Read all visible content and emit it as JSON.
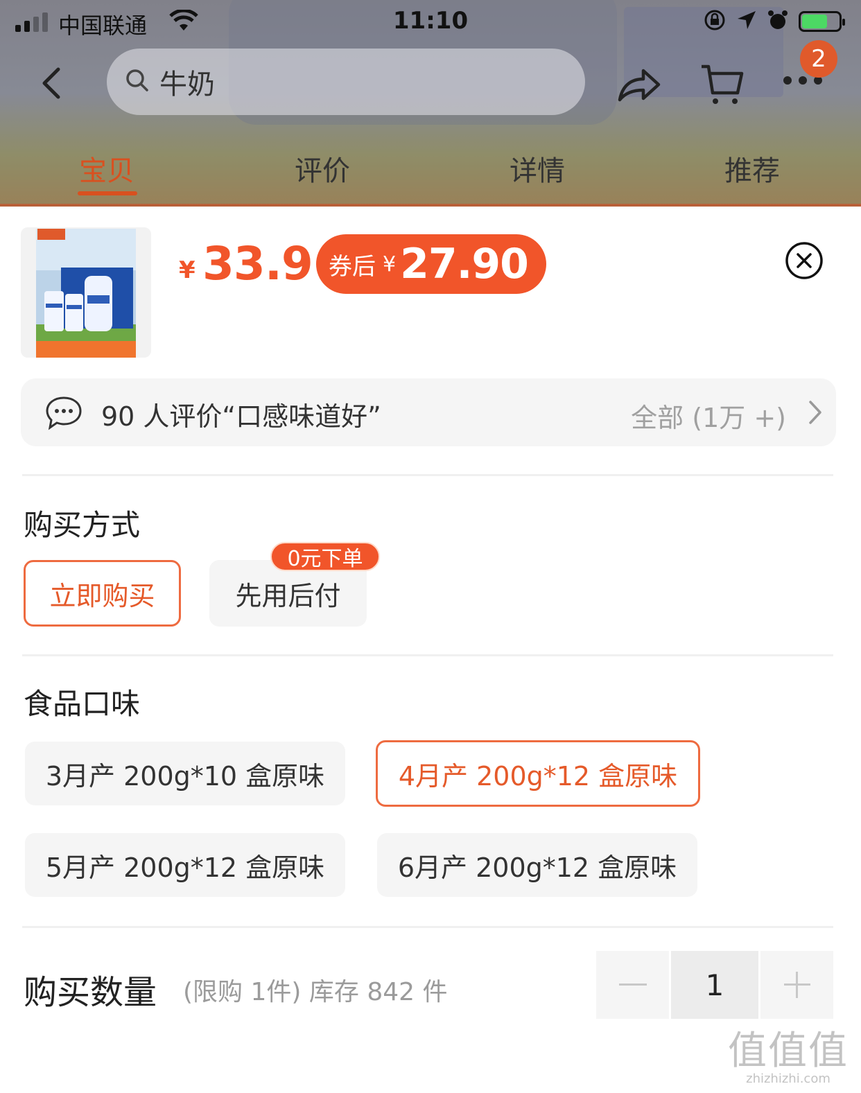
{
  "status_bar": {
    "carrier": "中国联通",
    "time": "11:10"
  },
  "nav": {
    "search_text": "牛奶",
    "cart_badge": "2"
  },
  "tabs": [
    {
      "label": "宝贝",
      "active": true
    },
    {
      "label": "评价",
      "active": false
    },
    {
      "label": "详情",
      "active": false
    },
    {
      "label": "推荐",
      "active": false
    }
  ],
  "product": {
    "currency": "¥",
    "price": "33.9",
    "coupon_label": "券后",
    "coupon_currency": "¥",
    "coupon_price": "27.90"
  },
  "review_bar": {
    "summary": "90 人评价“口感味道好”",
    "all_label": "全部 (1万 +)"
  },
  "purchase_method": {
    "title": "购买方式",
    "options": [
      {
        "label": "立即购买",
        "selected": true
      },
      {
        "label": "先用后付",
        "selected": false,
        "tag": "0元下单"
      }
    ]
  },
  "flavor": {
    "title": "食品口味",
    "options": [
      {
        "label": "3月产 200g*10 盒原味",
        "selected": false
      },
      {
        "label": "4月产 200g*12 盒原味",
        "selected": true
      },
      {
        "label": "5月产 200g*12 盒原味",
        "selected": false
      },
      {
        "label": "6月产 200g*12 盒原味",
        "selected": false
      }
    ]
  },
  "quantity": {
    "title": "购买数量",
    "note": "(限购 1件) 库存 842 件",
    "value": "1",
    "minus": "−",
    "plus": "+"
  },
  "watermark": {
    "logo": "值值值",
    "url": "zhizhizhi.com"
  },
  "colors": {
    "accent": "#f1552a",
    "selected_border": "#ee6b40",
    "chip_bg": "#f5f5f5"
  }
}
